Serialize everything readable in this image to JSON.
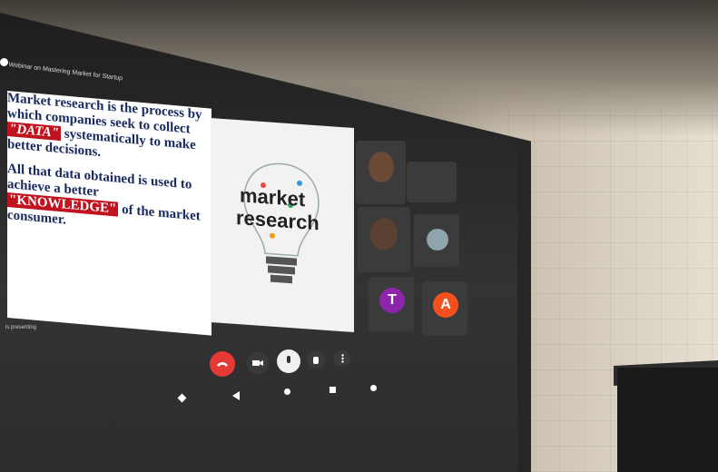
{
  "meeting": {
    "title": "Webinar on Mastering Market for Startup",
    "presenting_label": "is presenting"
  },
  "slide": {
    "paragraph1_a": "Market research is the process by which companies seek to collect",
    "highlight1": "\"DATA\"",
    "paragraph1_b": "systematically to make better decisions.",
    "paragraph2_a": "All that data obtained is used to achieve a better",
    "highlight2": "\"KNOWLEDGE\"",
    "paragraph2_b": "of the market consumer."
  },
  "poster": {
    "line1": "market",
    "line2": "research"
  },
  "participants": [
    {
      "initial": "T",
      "color": "#8e24aa"
    },
    {
      "initial": "A",
      "color": "#f4511e"
    }
  ],
  "controls": [
    "hang-up",
    "camera",
    "microphone",
    "hand",
    "more"
  ],
  "colors": {
    "hangup": "#e53935",
    "highlight": "#c1121f",
    "slide_text": "#18295e"
  }
}
